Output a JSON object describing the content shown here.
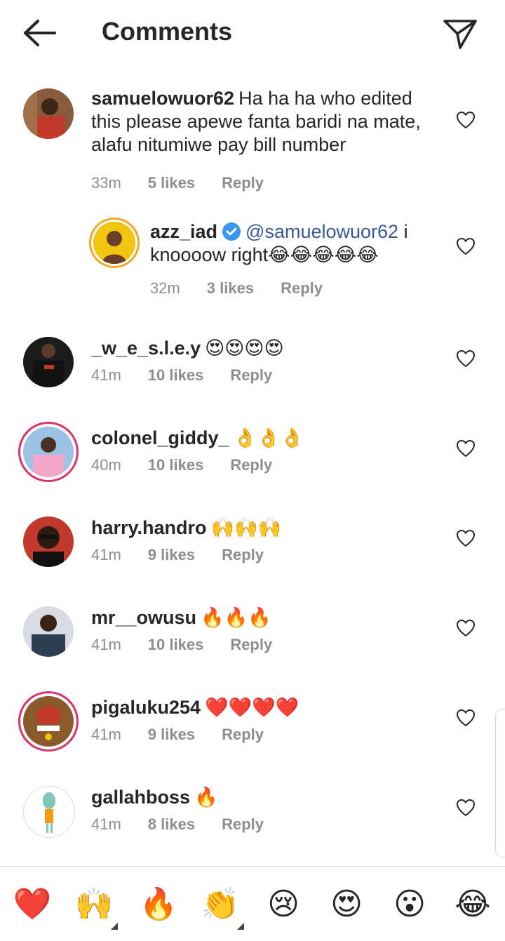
{
  "header": {
    "title": "Comments"
  },
  "comments": [
    {
      "username": "samuelowuor62",
      "text": "Ha ha ha who edited this please apewe fanta baridi na mate, alafu nitumiwe pay bill number",
      "time": "33m",
      "likes": "5 likes",
      "reply": "Reply"
    },
    {
      "username": "azz_iad",
      "mention": "@samuelowuor62",
      "text": " i knoooow right😂😂😂😂😂",
      "time": "32m",
      "likes": "3 likes",
      "reply": "Reply"
    },
    {
      "username": "_w_e_s.l.e.y",
      "text": "😍😍😍😍",
      "time": "41m",
      "likes": "10 likes",
      "reply": "Reply"
    },
    {
      "username": "colonel_giddy_",
      "text": "👌👌👌",
      "time": "40m",
      "likes": "10 likes",
      "reply": "Reply"
    },
    {
      "username": "harry.handro",
      "text": "🙌🙌🙌",
      "time": "41m",
      "likes": "9 likes",
      "reply": "Reply"
    },
    {
      "username": "mr__owusu",
      "text": "🔥🔥🔥",
      "time": "41m",
      "likes": "10 likes",
      "reply": "Reply"
    },
    {
      "username": "pigaluku254",
      "text": "❤️❤️❤️❤️",
      "time": "41m",
      "likes": "9 likes",
      "reply": "Reply"
    },
    {
      "username": "gallahboss",
      "text": "🔥",
      "time": "41m",
      "likes": "8 likes",
      "reply": "Reply"
    }
  ],
  "emoji_bar": [
    "❤️",
    "🙌",
    "🔥",
    "👏",
    "😢",
    "😍",
    "😮",
    "😂"
  ],
  "colors": {
    "accent": "#e1306c",
    "mention": "#385898",
    "verified": "#3897f0",
    "meta": "#8e8e8e"
  }
}
